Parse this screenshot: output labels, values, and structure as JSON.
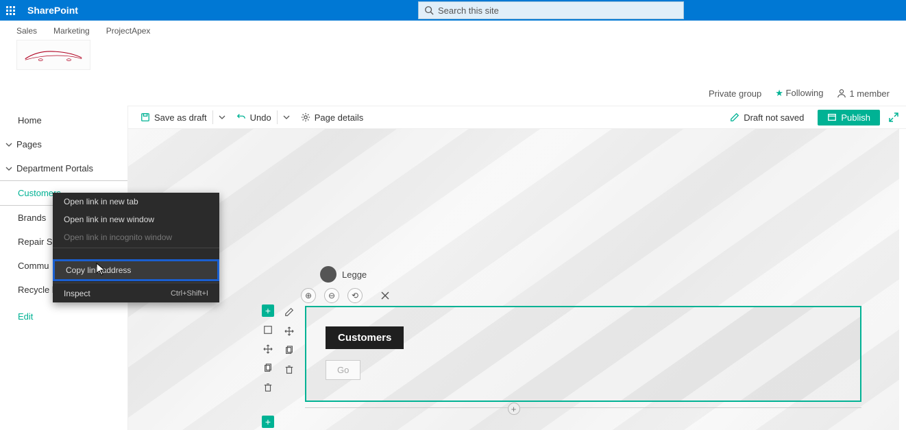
{
  "header": {
    "brand": "SharePoint",
    "search_placeholder": "Search this site"
  },
  "hub_nav": [
    "Sales",
    "Marketing",
    "ProjectApex"
  ],
  "site_info": {
    "privacy": "Private group",
    "following": "Following",
    "members": "1 member"
  },
  "cmd": {
    "save": "Save as draft",
    "undo": "Undo",
    "details": "Page details",
    "status": "Draft not saved",
    "publish": "Publish"
  },
  "nav": {
    "home": "Home",
    "pages": "Pages",
    "dept": "Department Portals",
    "items": [
      "Customers",
      "Brands",
      "Repair Sh",
      "Commu",
      "Recycle bin"
    ],
    "edit": "Edit"
  },
  "author": {
    "name": "Legge"
  },
  "webpart": {
    "title": "Customers",
    "go": "Go"
  },
  "ctx": {
    "open_tab": "Open link in new tab",
    "open_win": "Open link in new window",
    "open_inc": "Open link in incognito window",
    "copy": "Copy link address",
    "inspect": "Inspect",
    "shortcut": "Ctrl+Shift+I"
  }
}
